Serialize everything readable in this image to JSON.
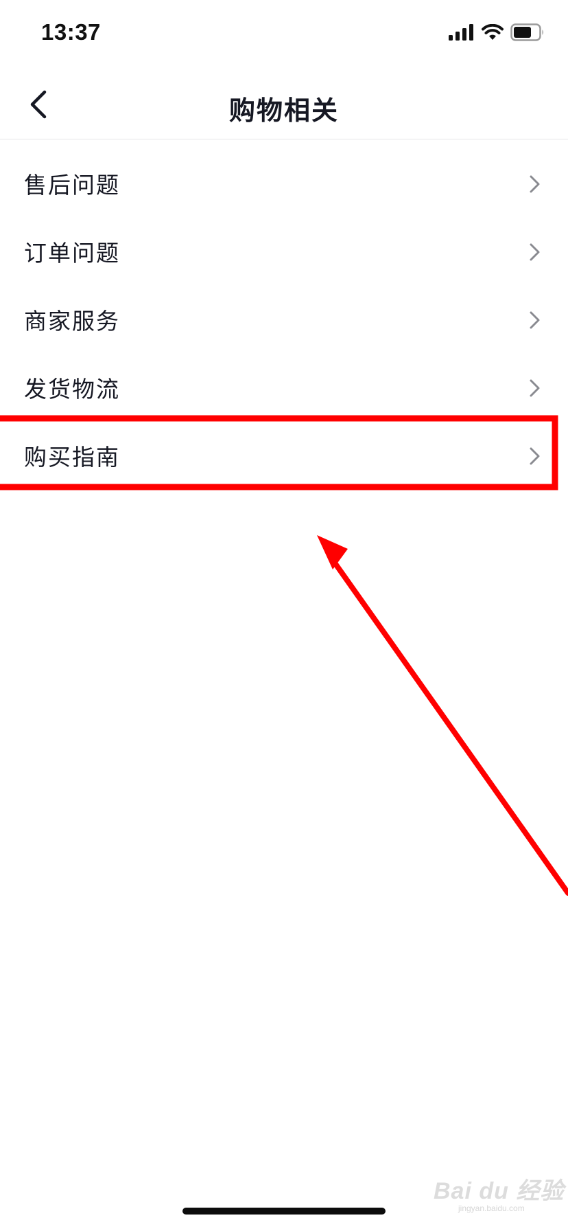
{
  "status_bar": {
    "time": "13:37",
    "icons": [
      "signal-icon",
      "wifi-icon",
      "battery-icon"
    ]
  },
  "nav": {
    "title": "购物相关",
    "back_icon": "chevron-left-icon"
  },
  "menu": {
    "items": [
      {
        "label": "售后问题"
      },
      {
        "label": "订单问题"
      },
      {
        "label": "商家服务"
      },
      {
        "label": "发货物流"
      },
      {
        "label": "购买指南"
      }
    ],
    "highlighted_item": "购买指南"
  },
  "colors": {
    "text": "#161823",
    "chevron": "#8a8b91",
    "divider": "#e6e6e8",
    "annotation": "#ff0000"
  },
  "watermark": {
    "brand": "Bai du 经验",
    "url": "jingyan.baidu.com"
  }
}
